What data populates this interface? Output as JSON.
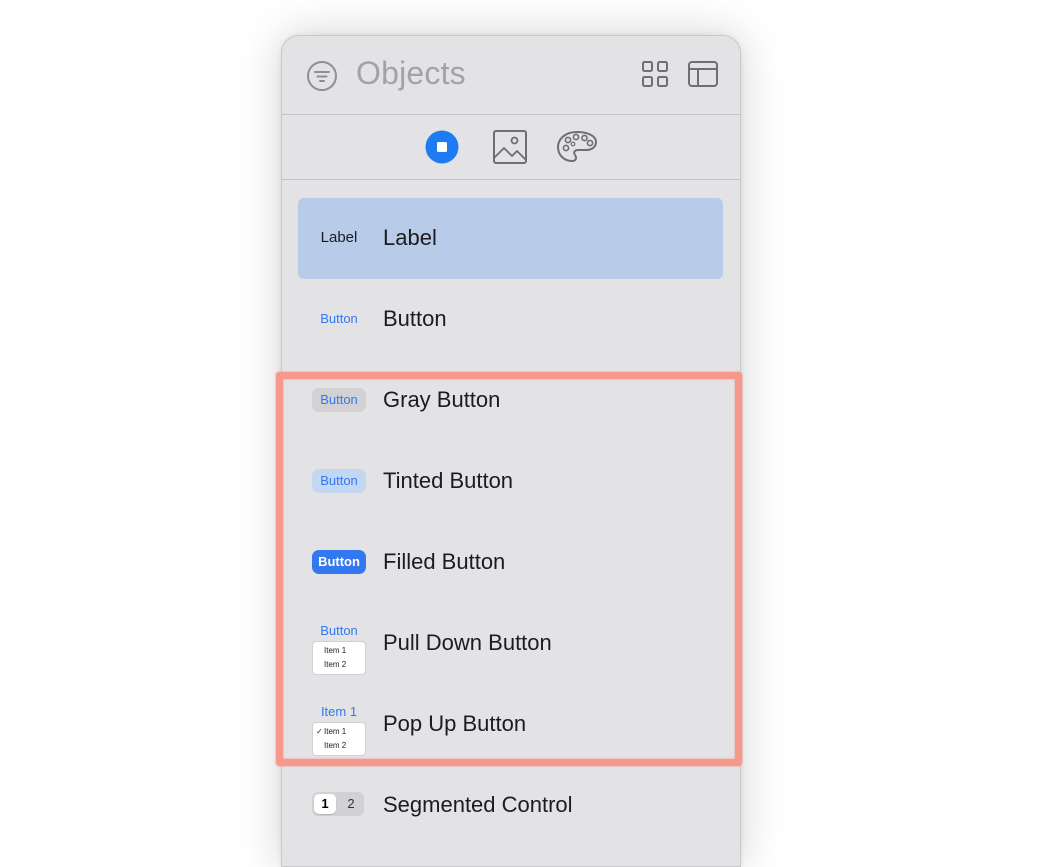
{
  "panel": {
    "title": "Objects",
    "icons": {
      "filter": "filter-icon",
      "grid": "grid-view-icon",
      "layout": "layout-panel-icon"
    },
    "tabs": [
      {
        "name": "objects",
        "icon": "square-stop-icon",
        "selected": true
      },
      {
        "name": "media",
        "icon": "image-icon",
        "selected": false
      },
      {
        "name": "colors",
        "icon": "palette-icon",
        "selected": false
      }
    ],
    "accent_color": "#3478f0",
    "selected_row_color": "#b8cbe8",
    "highlight_color": "#f7988d"
  },
  "items": [
    {
      "name": "Label",
      "thumb": "Label",
      "selected": true
    },
    {
      "name": "Button",
      "thumb": "Button"
    },
    {
      "name": "Gray Button",
      "thumb": "Button"
    },
    {
      "name": "Tinted Button",
      "thumb": "Button"
    },
    {
      "name": "Filled Button",
      "thumb": "Button"
    },
    {
      "name": "Pull Down Button",
      "thumb": "Button",
      "menu": [
        "Item 1",
        "Item 2"
      ]
    },
    {
      "name": "Pop Up Button",
      "thumb": "Item 1",
      "menu": [
        "Item 1",
        "Item 2"
      ],
      "check": "✓"
    },
    {
      "name": "Segmented Control",
      "segments": [
        "1",
        "2"
      ]
    }
  ]
}
